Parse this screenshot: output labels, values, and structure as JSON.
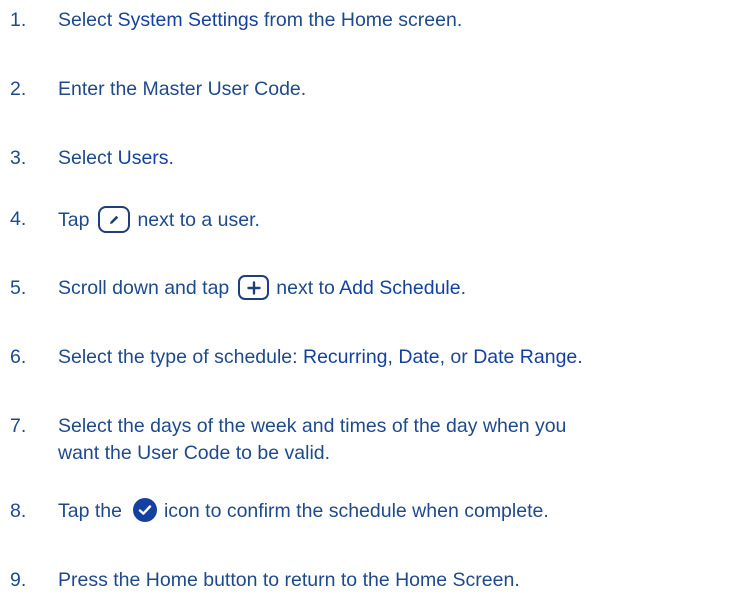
{
  "colors": {
    "text": "#1e4a8c",
    "highlight": "#1441a0",
    "icon_border": "#1e3f7a"
  },
  "steps": [
    {
      "num": "1.",
      "pre": "Select ",
      "hl1": "System Settings",
      "post": " from the Home screen."
    },
    {
      "num": "2.",
      "text": "Enter the Master User Code."
    },
    {
      "num": "3.",
      "pre": "Select ",
      "hl1": "Users",
      "post": "."
    },
    {
      "num": "4.",
      "pre": "Tap",
      "icon": "pencil-icon",
      "post": "next to a user."
    },
    {
      "num": "5.",
      "pre": "Scroll down and tap",
      "icon": "plus-icon",
      "mid": "next to ",
      "hl1": "Add Schedule",
      "post": "."
    },
    {
      "num": "6.",
      "pre": "Select the type of schedule: ",
      "hl1": "Recurring",
      "sep1": ", ",
      "hl2": "Date",
      "sep2": ", or ",
      "hl3": "Date Range."
    },
    {
      "num": "7.",
      "line1": "Select the days of the week and times of the day when you",
      "line2": "want the User Code to be valid."
    },
    {
      "num": "8.",
      "pre": "Tap the",
      "icon": "check-circle-icon",
      "post": "icon to confirm the schedule when complete."
    },
    {
      "num": "9.",
      "text": "Press the Home button to return to the Home Screen."
    }
  ]
}
